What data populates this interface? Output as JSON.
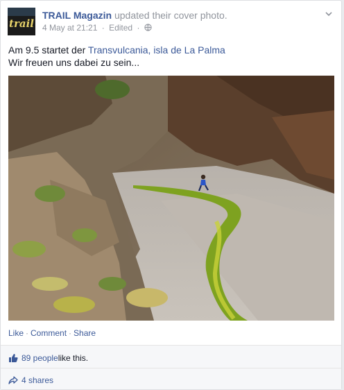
{
  "post": {
    "page_name": "TRAIL Magazin",
    "action": "updated their cover photo.",
    "date": "4 May at 21:21",
    "edited": "Edited",
    "avatar_text": "trail",
    "text_prefix": "Am 9.5 startet der ",
    "text_link": "Transvulcania, isla de La Palma",
    "text_line2": "Wir freuen uns dabei zu sein..."
  },
  "actions": {
    "like": "Like",
    "comment": "Comment",
    "share": "Share",
    "sep": "·"
  },
  "ufi": {
    "likes_count": "89 people",
    "likes_suffix": " like this.",
    "shares": "4 shares"
  },
  "colors": {
    "link": "#3b5998",
    "meta": "#90949c",
    "ufi_bg": "#f6f7f9"
  }
}
